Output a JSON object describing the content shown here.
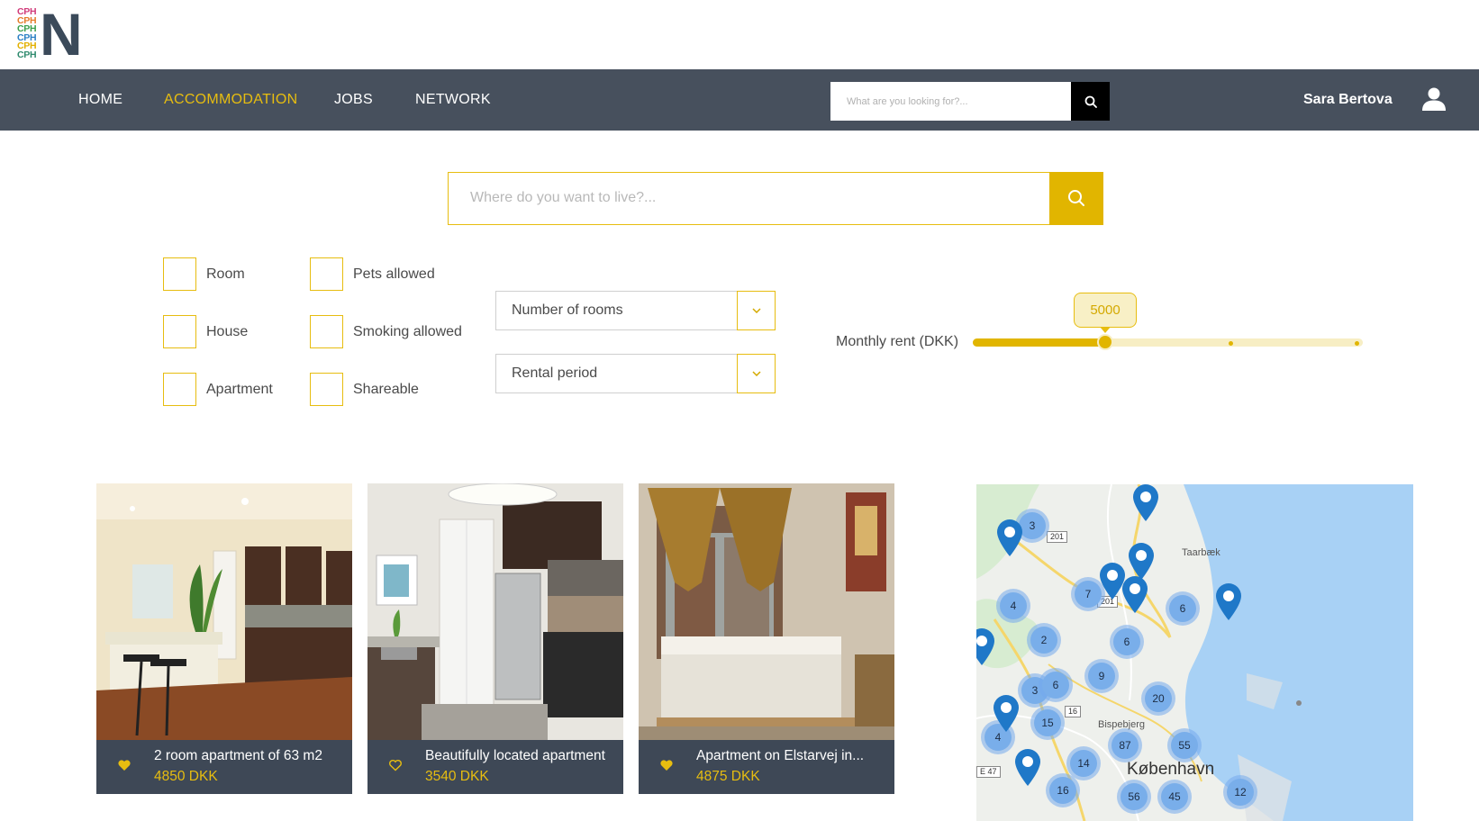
{
  "logo": {
    "lines": [
      "CPH",
      "CPH",
      "CPH",
      "CPH",
      "CPH",
      "CPH"
    ],
    "letter": "N",
    "line_colors": [
      "#d13b7a",
      "#e57b2a",
      "#3a9e4a",
      "#2b7fc4",
      "#e2b000",
      "#2e8a6d"
    ]
  },
  "nav": {
    "items": [
      {
        "label": "HOME",
        "active": false
      },
      {
        "label": "ACCOMMODATION",
        "active": true
      },
      {
        "label": "JOBS",
        "active": false
      },
      {
        "label": "NETWORK",
        "active": false
      }
    ],
    "search_placeholder": "What are you looking for?...",
    "search_icon": "search-icon",
    "user_name": "Sara Bertova",
    "user_icon": "user-icon"
  },
  "main_search": {
    "placeholder": "Where do you want to live?...",
    "icon": "search-icon"
  },
  "filters": {
    "type_checkboxes": [
      {
        "label": "Room",
        "checked": false
      },
      {
        "label": "House",
        "checked": false
      },
      {
        "label": "Apartment",
        "checked": false
      }
    ],
    "feature_checkboxes": [
      {
        "label": "Pets allowed",
        "checked": false
      },
      {
        "label": "Smoking allowed",
        "checked": false
      },
      {
        "label": "Shareable",
        "checked": false
      }
    ],
    "selects": [
      {
        "label": "Number of rooms",
        "icon": "chevron-down-icon"
      },
      {
        "label": "Rental period",
        "icon": "chevron-down-icon"
      }
    ],
    "rent": {
      "label": "Monthly rent (DKK)",
      "value": "5000",
      "fraction": 0.34
    }
  },
  "listings": [
    {
      "title": "2 room apartment of 63 m2",
      "price": "4850 DKK",
      "favorited": true
    },
    {
      "title": "Beautifully located apartment",
      "price": "3540 DKK",
      "favorited": false
    },
    {
      "title": "Apartment on Elstarvej in...",
      "price": "4875 DKK",
      "favorited": true
    }
  ],
  "map": {
    "clusters": [
      "3",
      "4",
      "7",
      "6",
      "2",
      "6",
      "9",
      "3",
      "6",
      "20",
      "15",
      "4",
      "87",
      "55",
      "14",
      "16",
      "56",
      "45",
      "12"
    ],
    "places": [
      "Taarbæk",
      "Bispebjerg",
      "København"
    ],
    "roads": [
      "201",
      "201",
      "16",
      "E 47"
    ]
  },
  "colors": {
    "accent": "#e1b500",
    "navbar": "#47505d",
    "card_info": "#3e4856",
    "map_water": "#a8d1f5"
  }
}
